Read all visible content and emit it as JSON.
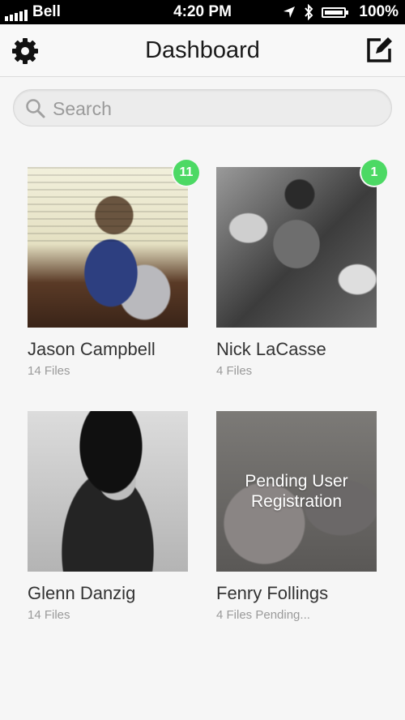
{
  "status_bar": {
    "carrier": "Bell",
    "time": "4:20 PM",
    "battery": "100%",
    "icons": [
      "signal-icon",
      "location-arrow-icon",
      "bluetooth-icon",
      "battery-icon"
    ]
  },
  "nav": {
    "title": "Dashboard",
    "left_icon": "gear-icon",
    "right_icon": "compose-icon"
  },
  "search": {
    "placeholder": "Search"
  },
  "colors": {
    "badge": "#4cd964",
    "background": "#f6f6f6",
    "title_text": "#1a1a1a",
    "subtitle_text": "#9a9a9a"
  },
  "users": [
    {
      "name": "Jason Campbell",
      "files": "14 Files",
      "badge": "11"
    },
    {
      "name": "Nick LaCasse",
      "files": "4 Files",
      "badge": "1"
    },
    {
      "name": "Glenn Danzig",
      "files": "14 Files"
    },
    {
      "name": "Fenry Follings",
      "files": "4 Files Pending...",
      "overlay": "Pending User Registration"
    }
  ]
}
